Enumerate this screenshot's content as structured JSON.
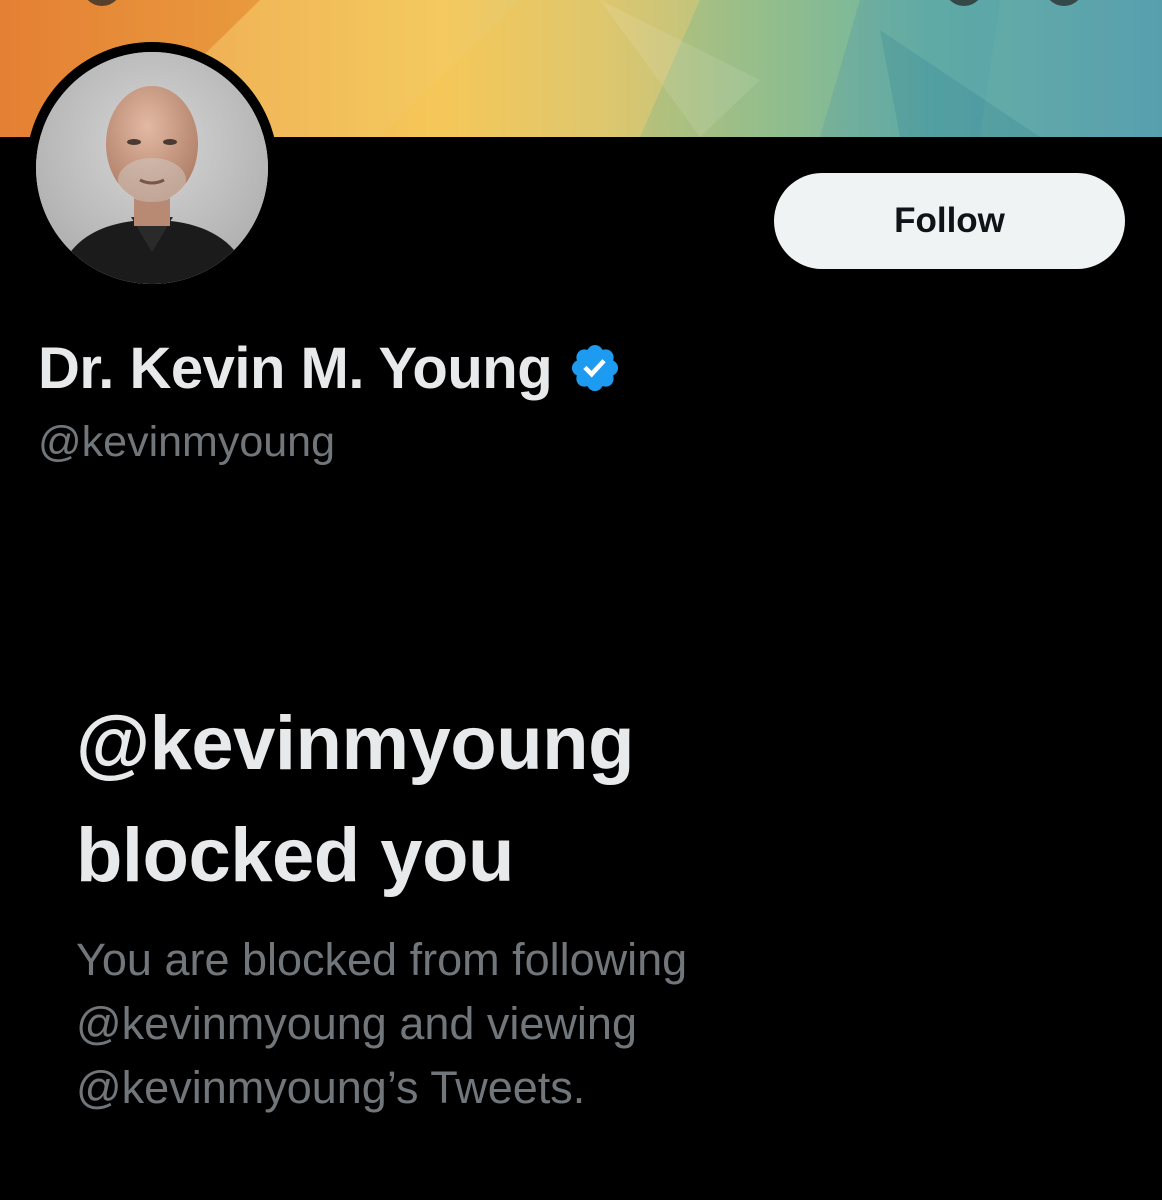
{
  "banner": {
    "colors": [
      "#e98a3a",
      "#f0b24a",
      "#f3c552",
      "#9cc08a",
      "#5aa2b0"
    ]
  },
  "profile": {
    "display_name": "Dr. Kevin M. Young",
    "handle": "@kevinmyoung",
    "verified": true,
    "verified_color": "#1d9bf0",
    "avatar_icon": "profile-photo"
  },
  "actions": {
    "follow_label": "Follow"
  },
  "blocked_notice": {
    "title_line1": "@kevinmyoung",
    "title_line2": "blocked you",
    "desc_line1": "You are blocked from following",
    "desc_line2": "@kevinmyoung and viewing",
    "desc_line3": "@kevinmyoung’s Tweets."
  },
  "colors": {
    "background": "#000000",
    "primary_text": "#e7e9ea",
    "secondary_text": "#71767b",
    "button_bg": "#eff3f4"
  }
}
